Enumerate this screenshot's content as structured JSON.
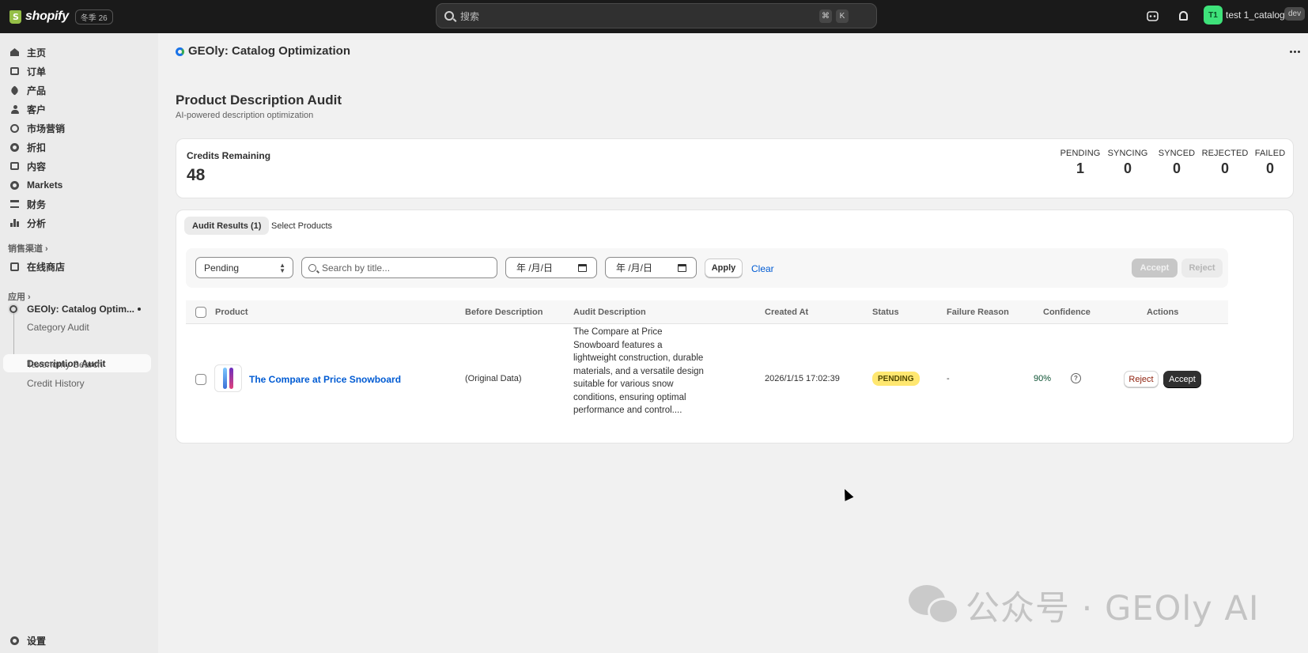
{
  "topbar": {
    "brand": "shopify",
    "edition": "冬季 26",
    "search_placeholder": "搜索",
    "shortcut_keys": [
      "⌘",
      "K"
    ],
    "avatar_initials": "T1",
    "store_name": "test 1_catalog",
    "dev_badge": "dev"
  },
  "sidebar": {
    "items": [
      {
        "label": "主页",
        "icon": "home-icon"
      },
      {
        "label": "订单",
        "icon": "inbox-icon"
      },
      {
        "label": "产品",
        "icon": "tag-icon"
      },
      {
        "label": "客户",
        "icon": "person-icon"
      },
      {
        "label": "市场营销",
        "icon": "target-icon"
      },
      {
        "label": "折扣",
        "icon": "discount-icon"
      },
      {
        "label": "内容",
        "icon": "content-icon"
      },
      {
        "label": "Markets",
        "icon": "globe-icon"
      },
      {
        "label": "财务",
        "icon": "bank-icon"
      },
      {
        "label": "分析",
        "icon": "bar-chart-icon"
      }
    ],
    "sales_channels_label": "销售渠道",
    "online_store_label": "在线商店",
    "apps_label": "应用",
    "app_name": "GEOly: Catalog Optim...",
    "app_subitems": [
      "Category Audit",
      "Description Audit",
      "Taxonomy Search",
      "Credit History"
    ],
    "active_subitem": "Description Audit",
    "settings_label": "设置"
  },
  "header": {
    "app_title": "GEOly: Catalog Optimization"
  },
  "page": {
    "title": "Product Description Audit",
    "subtitle": "AI-powered description optimization"
  },
  "credits": {
    "label": "Credits Remaining",
    "value": "48",
    "stats": [
      {
        "label": "PENDING",
        "value": "1"
      },
      {
        "label": "SYNCING",
        "value": "0"
      },
      {
        "label": "SYNCED",
        "value": "0"
      },
      {
        "label": "REJECTED",
        "value": "0"
      },
      {
        "label": "FAILED",
        "value": "0"
      }
    ]
  },
  "tabs": [
    "Audit Results (1)",
    "Select Products"
  ],
  "filters": {
    "status_value": "Pending",
    "search_placeholder": "Search by title...",
    "date_placeholder": "年 /月/日",
    "apply_label": "Apply",
    "clear_label": "Clear",
    "bulk_accept_label": "Accept",
    "bulk_reject_label": "Reject"
  },
  "table": {
    "columns": [
      "Product",
      "Before Description",
      "Audit Description",
      "Created At",
      "Status",
      "Failure Reason",
      "Confidence",
      "Actions"
    ],
    "rows": [
      {
        "product": "The Compare at Price Snowboard",
        "before": "(Original Data)",
        "audit": "The Compare at Price Snowboard features a lightweight construction, durable materials, and a versatile design suitable for various snow conditions, ensuring optimal performance and control....",
        "created_at": "2026/1/15 17:02:39",
        "status": "PENDING",
        "failure_reason": "-",
        "confidence": "90%",
        "reject_label": "Reject",
        "accept_label": "Accept"
      }
    ]
  },
  "colors": {
    "topbar": "#1a1a1a",
    "link": "#005bd3",
    "badge_pending": "#ffe770",
    "primary_button": "#303030"
  },
  "watermark": "公众号 · GEOly AI"
}
